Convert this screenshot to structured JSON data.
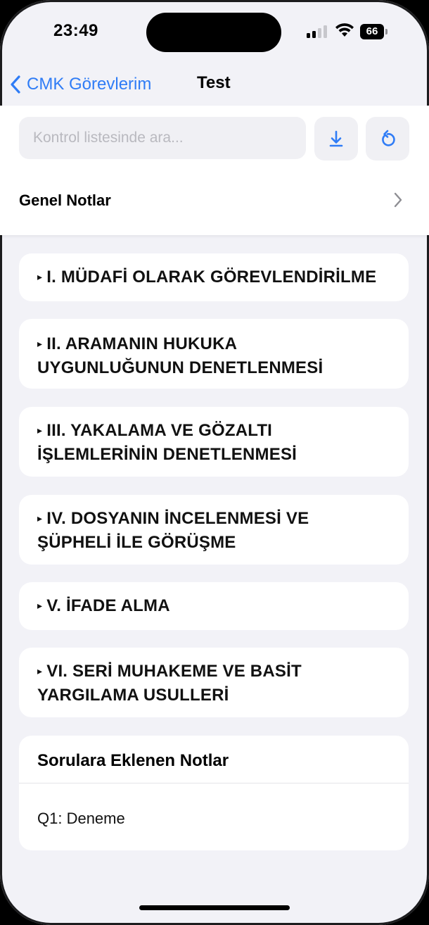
{
  "status_bar": {
    "time": "23:49",
    "battery": "66"
  },
  "nav": {
    "back_label": "CMK Görevlerim",
    "title": "Test"
  },
  "search": {
    "placeholder": "Kontrol listesinde ara..."
  },
  "general_notes": {
    "label": "Genel Notlar"
  },
  "sections": [
    {
      "line1": "I. MÜDAFİ OLARAK GÖREVLENDİRİLME",
      "line2": ""
    },
    {
      "line1": "II. ARAMANIN HUKUKA",
      "line2": "UYGUNLUĞUNUN DENETLENMESİ"
    },
    {
      "line1": "III. YAKALAMA VE GÖZALTI",
      "line2": "İŞLEMLERİNİN DENETLENMESİ"
    },
    {
      "line1": "IV. DOSYANIN İNCELENMESİ VE",
      "line2": "ŞÜPHELİ İLE GÖRÜŞME"
    },
    {
      "line1": "V. İFADE ALMA",
      "line2": ""
    },
    {
      "line1": "VI. SERİ MUHAKEME VE BASİT",
      "line2": "YARGILAMA USULLERİ"
    }
  ],
  "notes": {
    "title": "Sorulara Eklenen Notlar",
    "items": [
      "Q1: Deneme"
    ]
  },
  "colors": {
    "accent": "#2f7cf6",
    "background": "#f2f2f7",
    "card": "#ffffff"
  },
  "icons": {
    "back": "chevron-left-icon",
    "download": "download-icon",
    "refresh": "refresh-icon",
    "disclosure": "chevron-right-icon",
    "expand": "triangle-right-icon"
  }
}
